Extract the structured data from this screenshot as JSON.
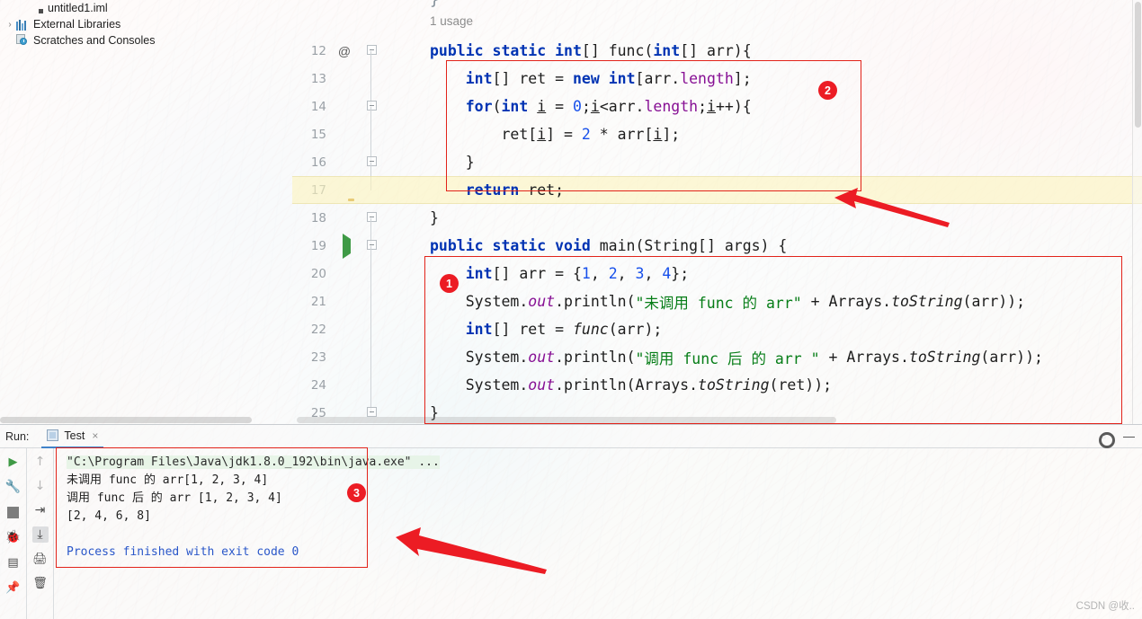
{
  "project_tree": {
    "items": [
      {
        "label": "untitled1.iml",
        "icon": "iml-file-icon",
        "arrow": "",
        "indent": 2
      },
      {
        "label": "External Libraries",
        "icon": "libraries-icon",
        "arrow": "›",
        "indent": 0
      },
      {
        "label": "Scratches and Consoles",
        "icon": "scratches-icon",
        "arrow": "",
        "indent": 1
      }
    ]
  },
  "editor": {
    "usage_hint": "1 usage",
    "top_brace": "}",
    "line_numbers": [
      "12",
      "13",
      "14",
      "15",
      "16",
      "17",
      "18",
      "19",
      "20",
      "21",
      "22",
      "23",
      "24",
      "25"
    ],
    "gutter_marks": {
      "annotation_at": "@",
      "bulb_line": "17",
      "run_line": "19"
    },
    "code": [
      "public static int[] func(int[] arr){",
      "    int[] ret = new int[arr.length];",
      "    for(int i = 0;i<arr.length;i++){",
      "        ret[i] = 2 * arr[i];",
      "    }",
      "    return ret;",
      "}",
      "public static void main(String[] args) {",
      "    int[] arr = {1, 2, 3, 4};",
      "    System.out.println(\"未调用 func 的 arr\" + Arrays.toString(arr));",
      "    int[] ret = func(arr);",
      "    System.out.println(\"调用 func 后 的 arr \" + Arrays.toString(arr));",
      "    System.out.println(Arrays.toString(ret));",
      "}"
    ]
  },
  "annotations": {
    "badges": [
      "2",
      "1",
      "3"
    ],
    "accent_color": "#ec1c24"
  },
  "run_panel": {
    "label": "Run:",
    "tab_name": "Test",
    "tab_close": "×",
    "gear_icon": "gear-icon",
    "minimize_icon": "minimize-icon",
    "toolbar_left": [
      "rerun-icon",
      "settings-wrench-icon",
      "stop-icon",
      "debug-icon",
      "layout-icon",
      "pin-icon"
    ],
    "toolbar_mid": [
      "up-arrow-icon",
      "down-arrow-icon",
      "soft-wrap-icon",
      "scroll-to-end-icon",
      "print-icon",
      "trash-icon"
    ],
    "console_lines": [
      {
        "text": "\"C:\\Program Files\\Java\\jdk1.8.0_192\\bin\\java.exe\" ...",
        "style": "cmd"
      },
      {
        "text": "未调用 func 的 arr[1, 2, 3, 4]",
        "style": "plain"
      },
      {
        "text": "调用 func 后 的 arr [1, 2, 3, 4]",
        "style": "plain"
      },
      {
        "text": "[2, 4, 6, 8]",
        "style": "plain"
      },
      {
        "text": "",
        "style": "blank"
      },
      {
        "text": "Process finished with exit code 0",
        "style": "exit"
      }
    ]
  },
  "watermark": {
    "text": "CSDN @收.."
  }
}
